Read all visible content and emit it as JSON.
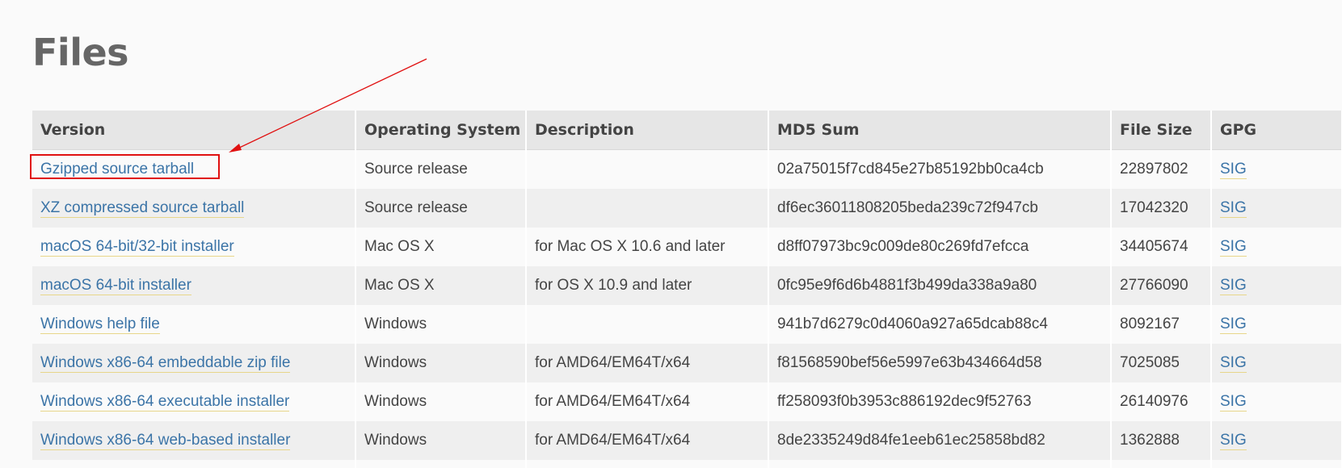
{
  "page": {
    "title": "Files"
  },
  "table": {
    "headers": [
      "Version",
      "Operating System",
      "Description",
      "MD5 Sum",
      "File Size",
      "GPG"
    ],
    "rows": [
      {
        "version": "Gzipped source tarball",
        "os": "Source release",
        "description": "",
        "md5": "02a75015f7cd845e27b85192bb0ca4cb",
        "size": "22897802",
        "gpg": "SIG"
      },
      {
        "version": "XZ compressed source tarball",
        "os": "Source release",
        "description": "",
        "md5": "df6ec36011808205beda239c72f947cb",
        "size": "17042320",
        "gpg": "SIG"
      },
      {
        "version": "macOS 64-bit/32-bit installer",
        "os": "Mac OS X",
        "description": "for Mac OS X 10.6 and later",
        "md5": "d8ff07973bc9c009de80c269fd7efcca",
        "size": "34405674",
        "gpg": "SIG"
      },
      {
        "version": "macOS 64-bit installer",
        "os": "Mac OS X",
        "description": "for OS X 10.9 and later",
        "md5": "0fc95e9f6d6b4881f3b499da338a9a80",
        "size": "27766090",
        "gpg": "SIG"
      },
      {
        "version": "Windows help file",
        "os": "Windows",
        "description": "",
        "md5": "941b7d6279c0d4060a927a65dcab88c4",
        "size": "8092167",
        "gpg": "SIG"
      },
      {
        "version": "Windows x86-64 embeddable zip file",
        "os": "Windows",
        "description": "for AMD64/EM64T/x64",
        "md5": "f81568590bef56e5997e63b434664d58",
        "size": "7025085",
        "gpg": "SIG"
      },
      {
        "version": "Windows x86-64 executable installer",
        "os": "Windows",
        "description": "for AMD64/EM64T/x64",
        "md5": "ff258093f0b3953c886192dec9f52763",
        "size": "26140976",
        "gpg": "SIG"
      },
      {
        "version": "Windows x86-64 web-based installer",
        "os": "Windows",
        "description": "for AMD64/EM64T/x64",
        "md5": "8de2335249d84fe1eeb61ec25858bd82",
        "size": "1362888",
        "gpg": "SIG"
      }
    ]
  },
  "annotation": {
    "highlight_color": "#e01010",
    "highlighted_row": "Gzipped source tarball"
  },
  "colors": {
    "link": "#3b74a7",
    "link_underline": "#e8d68a",
    "header_bg": "#e6e6e6",
    "row_alt_bg": "#efefef",
    "page_bg": "#fafafa"
  }
}
